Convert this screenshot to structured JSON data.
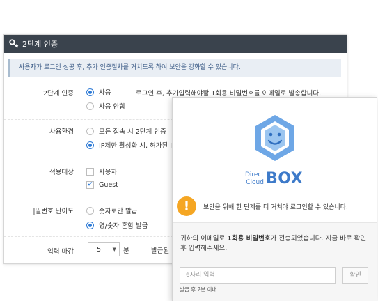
{
  "panel": {
    "title": "2단계 인증",
    "notice": "사용자가 로그인 성공 후, 추가 인증절차를 거치도록 하여 보안을 강화할 수 있습니다.",
    "auth": {
      "label": "2단계 인증",
      "options": [
        "사용",
        "사용 안함"
      ],
      "selected": "사용",
      "description": "로그인 후, 추가입력해야할 1회용 비밀번호를 이메일로 발송합니다."
    },
    "env": {
      "label": "사용환경",
      "options": [
        "모든 접속 시 2단계 인증",
        "IP제한 활성화 시, 허가된 I"
      ],
      "selected": "IP제한 활성화 시, 허가된 I"
    },
    "target": {
      "label": "적용대상",
      "options": [
        "사용자",
        "Guest"
      ],
      "checked": [
        "Guest"
      ]
    },
    "difficulty": {
      "label": "|밀번호 난이도",
      "options": [
        "숫자로만 발급",
        "영/숫자 혼합 발급"
      ],
      "selected": "영/숫자 혼합 발급"
    },
    "deadline": {
      "label": "입력 마감",
      "value": "5",
      "unit": "분",
      "trailing": "발급된"
    }
  },
  "card": {
    "brand_small_1": "Direct",
    "brand_small_2": "Cloud",
    "brand_big": "BOX",
    "warning": "보안을 위해 한 단계를 더 거쳐야 로그인할 수 있습니다.",
    "sent_message_pre": "귀하의 이메일로 ",
    "sent_message_bold": "1회용 비밀번호",
    "sent_message_post": "가 전송되었습니다. 지금 바로 확인 후 입력해주세요.",
    "input_placeholder": "6자리 입력",
    "confirm_button": "확인",
    "expire_note": "발급 후 2분 이내"
  },
  "colors": {
    "header_bg": "#3a434d",
    "accent": "#2d7ad6",
    "brand": "#3d7ac9",
    "warning": "#f5a623"
  },
  "icons": [
    "key-icon",
    "directcloud-logo-icon",
    "warning-icon",
    "chevron-down-icon"
  ]
}
